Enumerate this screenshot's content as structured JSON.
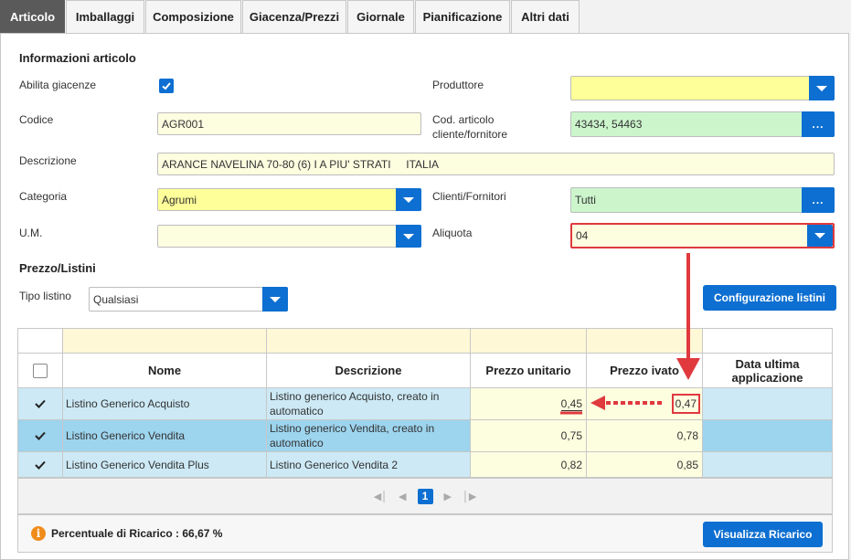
{
  "tabs": [
    {
      "label": "Articolo",
      "active": true
    },
    {
      "label": "Imballaggi"
    },
    {
      "label": "Composizione"
    },
    {
      "label": "Giacenza/Prezzi"
    },
    {
      "label": "Giornale"
    },
    {
      "label": "Pianificazione"
    },
    {
      "label": "Altri dati"
    }
  ],
  "info": {
    "title": "Informazioni articolo",
    "abilita_giacenze_label": "Abilita giacenze",
    "abilita_giacenze_checked": true,
    "codice_label": "Codice",
    "codice_value": "AGR001",
    "descrizione_label": "Descrizione",
    "descrizione_value": "ARANCE NAVELINA 70-80 (6) I A PIU' STRATI     ITALIA",
    "categoria_label": "Categoria",
    "categoria_value": "Agrumi",
    "um_label": "U.M.",
    "um_value": "",
    "produttore_label": "Produttore",
    "produttore_value": "",
    "cod_articolo_label_1": "Cod. articolo",
    "cod_articolo_label_2": "cliente/fornitore",
    "cod_articolo_value": "43434, 54463",
    "clienti_fornitori_label": "Clienti/Fornitori",
    "clienti_fornitori_value": "Tutti",
    "aliquota_label": "Aliquota",
    "aliquota_value": "04",
    "dots_label": "..."
  },
  "prezzo": {
    "title": "Prezzo/Listini",
    "tipo_listino_label": "Tipo listino",
    "tipo_listino_value": "Qualsiasi",
    "config_button": "Configurazione listini"
  },
  "table": {
    "columns": [
      "Nome",
      "Descrizione",
      "Prezzo unitario",
      "Prezzo ivato",
      "Data ultima applicazione"
    ],
    "rows": [
      {
        "nome": "Listino Generico Acquisto",
        "descrizione": "Listino generico Acquisto, creato in automatico",
        "prezzo_unitario": "0,45",
        "prezzo_ivato": "0,47",
        "data": ""
      },
      {
        "nome": "Listino Generico Vendita",
        "descrizione": "Listino generico Vendita, creato in automatico",
        "prezzo_unitario": "0,75",
        "prezzo_ivato": "0,78",
        "data": ""
      },
      {
        "nome": "Listino Generico Vendita Plus",
        "descrizione": "Listino Generico Vendita 2",
        "prezzo_unitario": "0,82",
        "prezzo_ivato": "0,85",
        "data": ""
      }
    ],
    "pager": {
      "current_page": "1"
    }
  },
  "footer": {
    "ricarico_text": "Percentuale di Ricarico : 66,67 %",
    "visualizza_button": "Visualizza Ricarico"
  },
  "colors": {
    "accent": "#0d6fd1",
    "annotation": "#e0393e",
    "active_tab": "#5a5a5a"
  },
  "icons": [
    "checkbox-checked-icon",
    "caret-down-icon",
    "check-icon",
    "info-icon",
    "first-page-icon",
    "prev-page-icon",
    "next-page-icon",
    "last-page-icon"
  ]
}
